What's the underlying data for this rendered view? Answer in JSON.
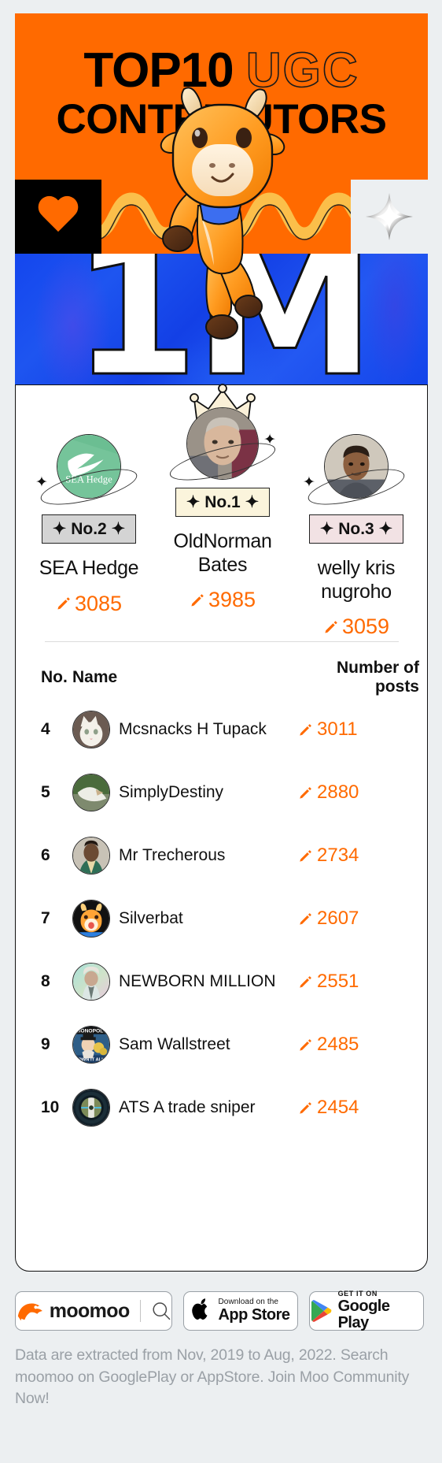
{
  "hero": {
    "title_solid": "TOP10",
    "title_outline": "UGC",
    "subtitle": "CONTRIBUTORS",
    "milestone": "1M",
    "icons": {
      "heart": "heart-icon",
      "sparkle": "sparkle-icon",
      "wave": "wave-line"
    },
    "colors": {
      "orange": "#FF6A00",
      "blue": "#1446EE",
      "black": "#000000"
    }
  },
  "podium": [
    {
      "rank_label": "No.2",
      "name": "SEA Hedge",
      "score": "3085",
      "badge_color": "#D4D4D4",
      "avatar_type": "sea-hedge-logo",
      "avatar_text": "SEA Hedge"
    },
    {
      "rank_label": "No.1",
      "name": "OldNorman Bates",
      "score": "3985",
      "badge_color": "#FBF4DC",
      "avatar_type": "photo-man-glasses",
      "crown": true
    },
    {
      "rank_label": "No.3",
      "name": "welly kris nugroho",
      "score": "3059",
      "badge_color": "#F2E2E4",
      "avatar_type": "photo-man"
    }
  ],
  "table": {
    "headers": {
      "no": "No.",
      "name": "Name",
      "posts": "Number of posts"
    },
    "rows": [
      {
        "no": "4",
        "name": "Mcsnacks H Tupack",
        "posts": "3011",
        "avatar": "white-cat-photo"
      },
      {
        "no": "5",
        "name": "SimplyDestiny",
        "posts": "2880",
        "avatar": "eagle-photo"
      },
      {
        "no": "6",
        "name": "Mr Trecherous",
        "posts": "2734",
        "avatar": "man-portrait-photo"
      },
      {
        "no": "7",
        "name": "Silverbat",
        "posts": "2607",
        "avatar": "cow-emoji-avatar"
      },
      {
        "no": "8",
        "name": "NEWBORN MILLION",
        "posts": "2551",
        "avatar": "figure-photo"
      },
      {
        "no": "9",
        "name": "Sam Wallstreet",
        "posts": "2485",
        "avatar": "monopoly-photo"
      },
      {
        "no": "10",
        "name": "ATS A trade sniper",
        "posts": "2454",
        "avatar": "scope-photo"
      }
    ]
  },
  "footer": {
    "moomoo_label": "moomoo",
    "appstore_small": "Download on the",
    "appstore_big": "App Store",
    "googleplay_small": "GET IT ON",
    "googleplay_big": "Google Play",
    "disclaimer": "Data are extracted from Nov, 2019 to Aug, 2022. Search moomoo on GooglePlay or AppStore. Join Moo Community Now!"
  }
}
